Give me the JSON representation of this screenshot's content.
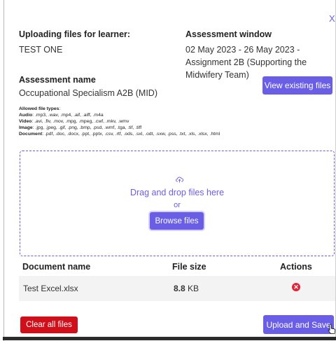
{
  "header": {
    "close_icon": "close-icon",
    "learner_label": "Uploading files for learner:",
    "learner_value": "TEST ONE",
    "window_label": "Assessment window",
    "window_value": "02 May 2023 - 26 May 2023 - Assignment 2B (Supporting the Midwifery Team)"
  },
  "assessment": {
    "label": "Assessment name",
    "value": "Occupational Specialism A2B (MID)",
    "view_button": "View existing files"
  },
  "allowed_types": {
    "title": "Allowed file types",
    "title_suffix": ":",
    "lines": [
      {
        "kind": "Audio",
        "list": ": .mp3, .wav, .mp4, .aif, .aiff, .m4a"
      },
      {
        "kind": "Video",
        "list": ": .avi, .flv, .mov, .mpg, .mpeg, .cwf, .mkv, .wmv"
      },
      {
        "kind": "Image",
        "list": ": .jpg, .jpeg, .gif, .png, .bmp, .psd, .wmf, .tga, .tif, .tiff"
      },
      {
        "kind": "Document",
        "list": ": .pdf, .doc, .docx, .ppt, .pptx, .csv, .rtf, .ods, .sxl, .odt, .sxw, .pss, .txt, .xls, .xlsx, .html"
      }
    ]
  },
  "dropzone": {
    "icon": "upload-cloud-icon",
    "text": "Drag and drop files here",
    "or": "or",
    "browse_button": "Browse files"
  },
  "table": {
    "columns": [
      "Document name",
      "File size",
      "Actions"
    ],
    "rows": [
      {
        "name": "Test Excel.xlsx",
        "size_value": "8.8",
        "size_unit": " KB",
        "action_icon": "remove-icon"
      }
    ]
  },
  "footer": {
    "clear_button": "Clear all files",
    "save_button": "Upload and Save"
  },
  "colors": {
    "accent": "#6a5ee6",
    "danger": "#d10f1b",
    "remove": "#e0243a"
  }
}
